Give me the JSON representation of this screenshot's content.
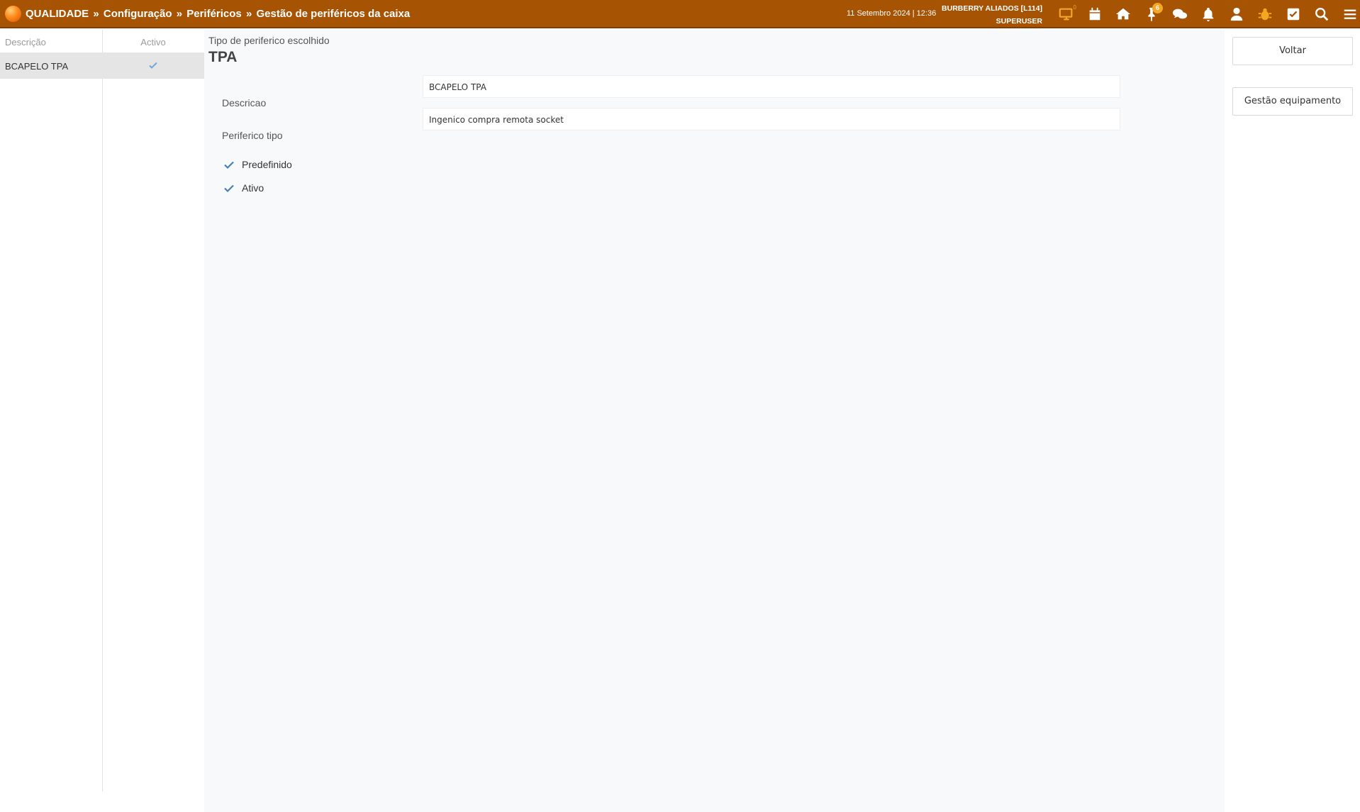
{
  "header": {
    "breadcrumb": [
      "QUALIDADE",
      "Configuração",
      "Periféricos",
      "Gestão de periféricos da caixa"
    ],
    "separator": "»",
    "datetime": "11 Setembro 2024 | 12:36",
    "store": "BURBERRY ALIADOS [L114]",
    "user": "SUPERUSER",
    "icons": [
      "monitor-icon",
      "calendar-icon",
      "home-icon",
      "pin-icon",
      "chat-icon",
      "bell-icon",
      "user-icon",
      "bug-icon",
      "checkbox-icon",
      "search-icon",
      "menu-icon"
    ],
    "pin_badge": "6",
    "monitor_sup": "0",
    "accent_color": "#a65304",
    "highlight_color": "#f5a623"
  },
  "list": {
    "columns": [
      "Descrição",
      "Activo"
    ],
    "rows": [
      {
        "descricao": "BCAPELO TPA",
        "activo": true
      }
    ]
  },
  "main": {
    "subtitle": "Tipo de periferico escolhido",
    "title": "TPA",
    "fields": [
      {
        "label": "Descricao",
        "value": "BCAPELO TPA"
      },
      {
        "label": "Periferico tipo",
        "value": "Ingenico compra remota socket"
      }
    ],
    "checks": [
      {
        "label": "Predefinido",
        "checked": true
      },
      {
        "label": "Ativo",
        "checked": true
      }
    ]
  },
  "actions": {
    "back": "Voltar",
    "manage_equipment": "Gestão equipamento"
  }
}
